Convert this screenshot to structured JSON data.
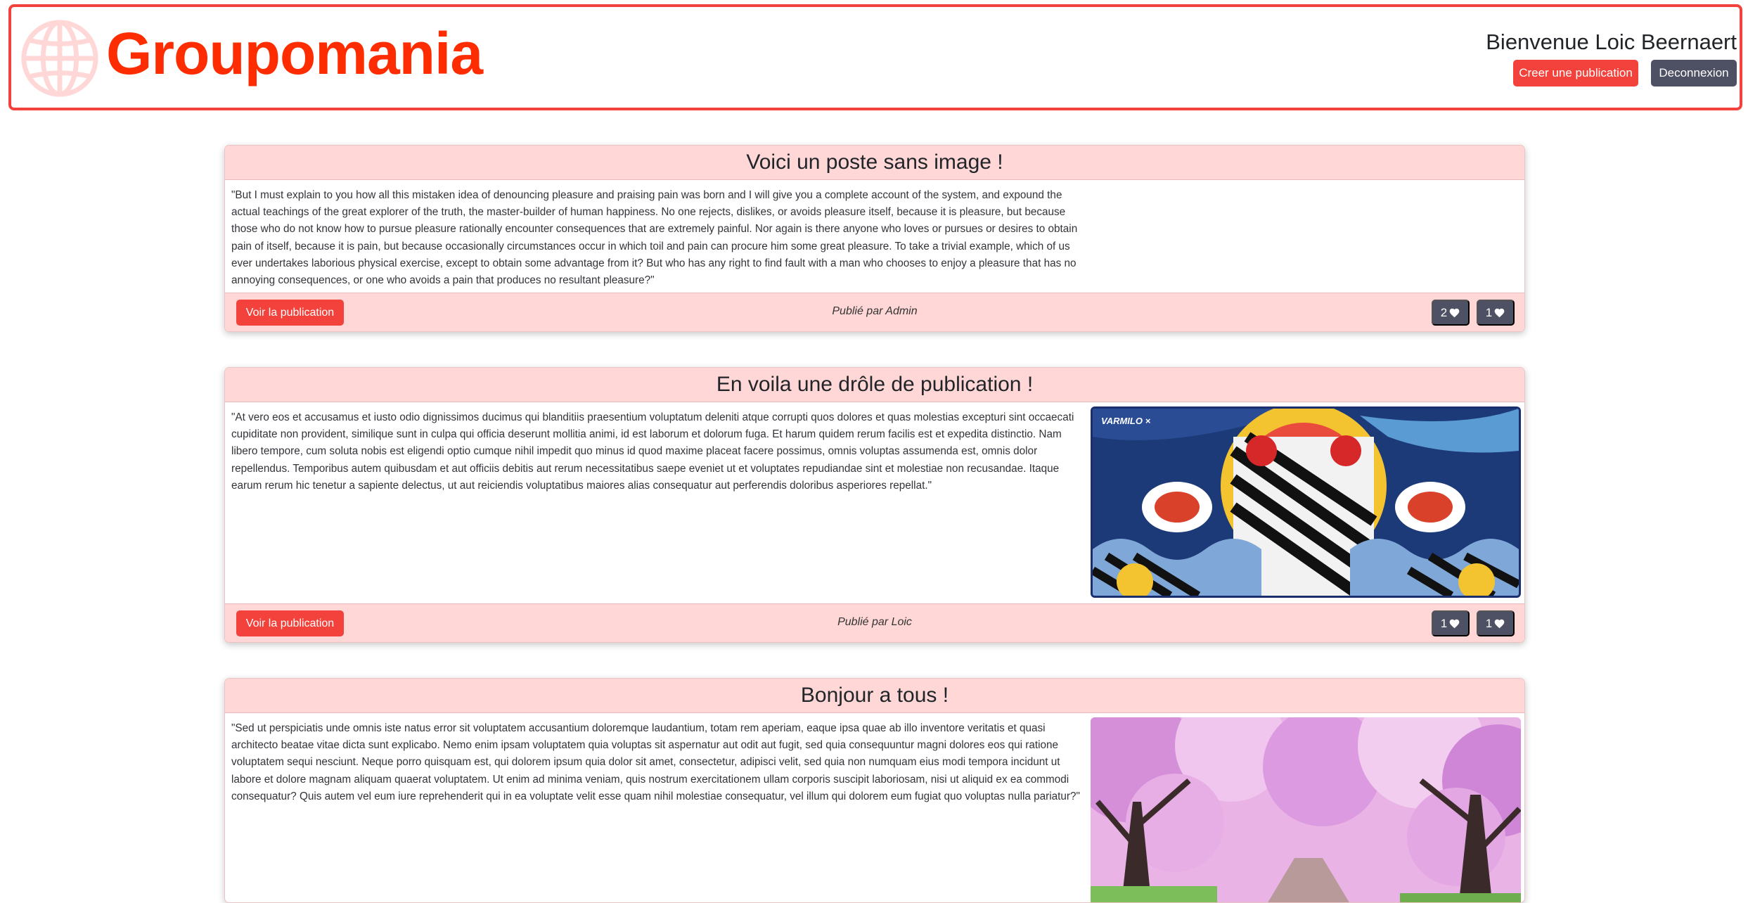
{
  "header": {
    "brand": "Groupomania",
    "welcome": "Bienvenue Loic Beernaert",
    "create_label": "Creer une publication",
    "logout_label": "Deconnexion"
  },
  "posts": [
    {
      "title": "Voici un poste sans image !",
      "text": "\"But I must explain to you how all this mistaken idea of denouncing pleasure and praising pain was born and I will give you a complete account of the system, and expound the actual teachings of the great explorer of the truth, the master-builder of human happiness. No one rejects, dislikes, or avoids pleasure itself, because it is pleasure, but because those who do not know how to pursue pleasure rationally encounter consequences that are extremely painful. Nor again is there anyone who loves or pursues or desires to obtain pain of itself, because it is pain, but because occasionally circumstances occur in which toil and pain can procure him some great pleasure. To take a trivial example, which of us ever undertakes laborious physical exercise, except to obtain some advantage from it? But who has any right to find fault with a man who chooses to enjoy a pleasure that has no annoying consequences, or one who avoids a pain that produces no resultant pleasure?\"",
      "view_label": "Voir la publication",
      "author": "Publié par Admin",
      "likes": "2",
      "dislikes": "1"
    },
    {
      "title": "En voila une drôle de publication !",
      "text": "\"At vero eos et accusamus et iusto odio dignissimos ducimus qui blanditiis praesentium voluptatum deleniti atque corrupti quos dolores et quas molestias excepturi sint occaecati cupiditate non provident, similique sunt in culpa qui officia deserunt mollitia animi, id est laborum et dolorum fuga. Et harum quidem rerum facilis est et expedita distinctio. Nam libero tempore, cum soluta nobis est eligendi optio cumque nihil impedit quo minus id quod maxime placeat facere possimus, omnis voluptas assumenda est, omnis dolor repellendus. Temporibus autem quibusdam et aut officiis debitis aut rerum necessitatibus saepe eveniet ut et voluptates repudiandae sint et molestiae non recusandae. Itaque earum rerum hic tenetur a sapiente delectus, ut aut reiciendis voluptatibus maiores alias consequatur aut perferendis doloribus asperiores repellat.\"",
      "image_label": "VARMILO ×",
      "view_label": "Voir la publication",
      "author": "Publié par Loic",
      "likes": "1",
      "dislikes": "1"
    },
    {
      "title": "Bonjour a tous !",
      "text": "\"Sed ut perspiciatis unde omnis iste natus error sit voluptatem accusantium doloremque laudantium, totam rem aperiam, eaque ipsa quae ab illo inventore veritatis et quasi architecto beatae vitae dicta sunt explicabo. Nemo enim ipsam voluptatem quia voluptas sit aspernatur aut odit aut fugit, sed quia consequuntur magni dolores eos qui ratione voluptatem sequi nesciunt. Neque porro quisquam est, qui dolorem ipsum quia dolor sit amet, consectetur, adipisci velit, sed quia non numquam eius modi tempora incidunt ut labore et dolore magnam aliquam quaerat voluptatem. Ut enim ad minima veniam, quis nostrum exercitationem ullam corporis suscipit laboriosam, nisi ut aliquid ex ea commodi consequatur? Quis autem vel eum iure reprehenderit qui in ea voluptate velit esse quam nihil molestiae consequatur, vel illum qui dolorem eum fugiat quo voluptas nulla pariatur?\""
    }
  ],
  "colors": {
    "brand": "#fd2d01",
    "accent": "#f2423b",
    "card_header": "#ffd7d7",
    "dark_button": "#4e5064"
  },
  "icons": {
    "logo": "globe-icon",
    "vote": "heart-icon"
  }
}
